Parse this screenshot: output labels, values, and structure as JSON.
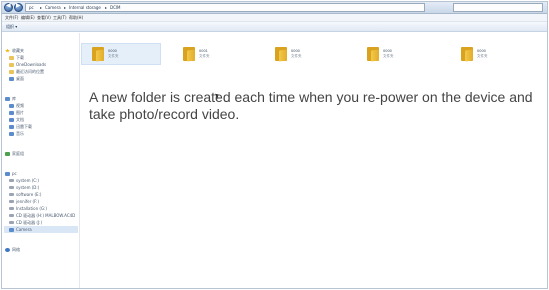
{
  "address_bar": {
    "breadcrumbs": [
      "pc",
      "Camera",
      "Internal storage",
      "DCIM"
    ]
  },
  "menu": {
    "items": [
      "文件(F)",
      "编辑(E)",
      "查看(V)",
      "工具(T)",
      "帮助(H)"
    ]
  },
  "toolbar": {
    "organize_label": "组织 ▾"
  },
  "sidebar": {
    "items": [
      {
        "label": "收藏夹",
        "icon": "star-icon"
      },
      {
        "label": "下载",
        "icon": "folder-icon"
      },
      {
        "label": "OneDownloads",
        "icon": "folder-icon"
      },
      {
        "label": "最近访问的位置",
        "icon": "folder-icon"
      },
      {
        "label": "桌面",
        "icon": "folder-icon"
      },
      {
        "label": "库",
        "icon": "library-icon"
      },
      {
        "label": "视频",
        "icon": "library-icon"
      },
      {
        "label": "图片",
        "icon": "library-icon"
      },
      {
        "label": "文档",
        "icon": "library-icon"
      },
      {
        "label": "迅雷下载",
        "icon": "library-icon"
      },
      {
        "label": "音乐",
        "icon": "library-icon"
      },
      {
        "label": "家庭组",
        "icon": "homegroup-icon"
      },
      {
        "label": "pc",
        "icon": "computer-icon"
      },
      {
        "label": "system (C:)",
        "icon": "drive-icon"
      },
      {
        "label": "system (D:)",
        "icon": "drive-icon"
      },
      {
        "label": "software (E:)",
        "icon": "drive-icon"
      },
      {
        "label": "jennifer (F:)",
        "icon": "drive-icon"
      },
      {
        "label": "Installation (G:)",
        "icon": "drive-icon"
      },
      {
        "label": "CD 驱动器 (H:) MALBOW.AC4D",
        "icon": "cd-drive-icon"
      },
      {
        "label": "CD 驱动器 (J:)",
        "icon": "cd-drive-icon"
      },
      {
        "label": "Camera",
        "icon": "camera-icon"
      },
      {
        "label": "网络",
        "icon": "network-icon"
      }
    ]
  },
  "files": [
    {
      "name": "0000",
      "type": "文件夹"
    },
    {
      "name": "0001",
      "type": "文件夹"
    },
    {
      "name": "0000",
      "type": "文件夹"
    },
    {
      "name": "0000",
      "type": "文件夹"
    },
    {
      "name": "0000",
      "type": "文件夹"
    }
  ],
  "caption": "A new folder is created each time when you re-power on the device and take photo/record video."
}
